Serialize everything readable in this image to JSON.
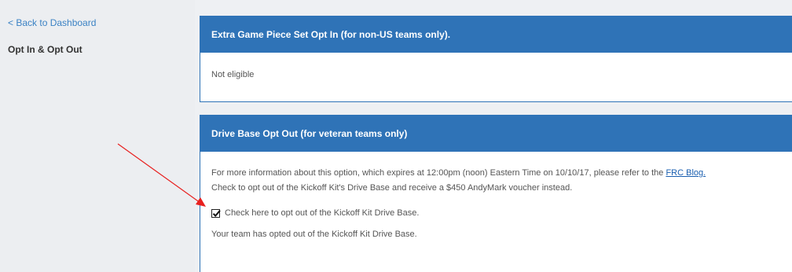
{
  "sidebar": {
    "back_link": "< Back to Dashboard",
    "title": "Opt In & Opt Out"
  },
  "panels": {
    "extra_game_piece": {
      "header": "Extra Game Piece Set Opt In (for non-US teams only).",
      "status": "Not eligible"
    },
    "drive_base": {
      "header": "Drive Base Opt Out (for veteran teams only)",
      "info_prefix": "For more information about this option, which expires at 12:00pm (noon) Eastern Time on 10/10/17, please refer to the",
      "info_link": "FRC Blog.",
      "instruction": "Check to opt out of the Kickoff Kit's Drive Base and receive a $450 AndyMark voucher instead.",
      "checkbox_label": "Check here to opt out of the Kickoff Kit Drive Base.",
      "checkbox_checked": true,
      "confirmation": "Your team has opted out of the Kickoff Kit Drive Base."
    }
  },
  "colors": {
    "header_blue": "#2f73b7",
    "link_blue": "#3b82c4",
    "annotation_arrow": "#e8201f"
  },
  "icons": {
    "annotation": "red-arrow-icon",
    "checkbox": "checkmark-icon"
  }
}
